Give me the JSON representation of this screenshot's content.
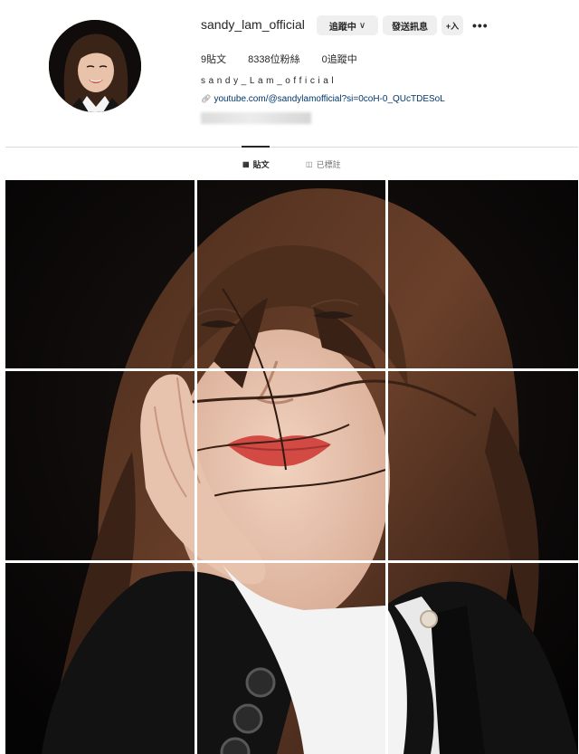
{
  "profile": {
    "username": "sandy_lam_official",
    "full_name": "sandy_Lam_official",
    "link": "youtube.com/@sandylamofficial?si=0coH-0_QUcTDESoL",
    "avatar_icon": "profile-photo"
  },
  "actions": {
    "following_label": "追蹤中",
    "message_label": "發送訊息",
    "add_user_label": "+入",
    "more_label": "•••"
  },
  "stats": {
    "posts": "9貼文",
    "followers": "8338位粉絲",
    "following": "0追蹤中"
  },
  "tabs": [
    {
      "label": "貼文",
      "icon": "grid-icon",
      "active": true
    },
    {
      "label": "已標註",
      "icon": "tag-icon",
      "active": false
    }
  ],
  "grid": {
    "rows": 3,
    "columns": 3,
    "posts": 9
  }
}
